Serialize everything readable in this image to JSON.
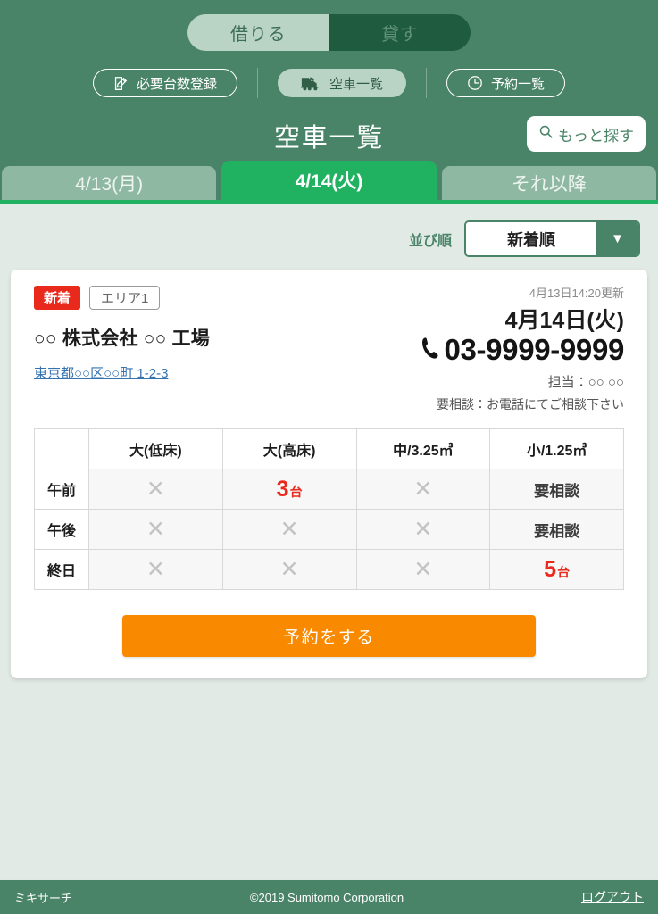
{
  "header": {
    "mode_toggle": {
      "borrow_label": "借りる",
      "lend_label": "貸す",
      "selected": "借りる"
    },
    "nav": [
      {
        "label": "必要台数登録",
        "icon": "edit-document-icon",
        "active": false
      },
      {
        "label": "空車一覧",
        "icon": "truck-icon",
        "active": true
      },
      {
        "label": "予約一覧",
        "icon": "clock-icon",
        "active": false
      }
    ],
    "page_title": "空車一覧",
    "search_button": {
      "label": "もっと探す",
      "icon": "search-icon"
    },
    "tabs": [
      {
        "label": "4/13(月)",
        "active": false
      },
      {
        "label": "4/14(火)",
        "active": true
      },
      {
        "label": "それ以降",
        "active": false
      }
    ]
  },
  "sort": {
    "label": "並び順",
    "value": "新着順",
    "arrow": "▼"
  },
  "card": {
    "badge_new": "新着",
    "badge_area": "エリア1",
    "company": "○○ 株式会社 ○○ 工場",
    "address": "東京都○○区○○町 1-2-3",
    "updated": "4月13日14:20更新",
    "reservation_date": "4月14日(火)",
    "phone": "03-9999-9999",
    "phone_icon": "phone-icon",
    "person": "担当：○○ ○○",
    "note": "要相談：お電話にてご相談下さい",
    "reserve_button": "予約をする"
  },
  "table": {
    "corner": "",
    "columns": [
      "大(低床)",
      "大(高床)",
      "中/3.25㎥",
      "小/1.25㎥"
    ],
    "rows": [
      {
        "label": "午前",
        "cells": [
          {
            "type": "none",
            "text": "✕"
          },
          {
            "type": "count",
            "value": "3",
            "unit": "台"
          },
          {
            "type": "none",
            "text": "✕"
          },
          {
            "type": "consult",
            "text": "要相談"
          }
        ]
      },
      {
        "label": "午後",
        "cells": [
          {
            "type": "none",
            "text": "✕"
          },
          {
            "type": "none",
            "text": "✕"
          },
          {
            "type": "none",
            "text": "✕"
          },
          {
            "type": "consult",
            "text": "要相談"
          }
        ]
      },
      {
        "label": "終日",
        "cells": [
          {
            "type": "none",
            "text": "✕"
          },
          {
            "type": "none",
            "text": "✕"
          },
          {
            "type": "none",
            "text": "✕"
          },
          {
            "type": "count",
            "value": "5",
            "unit": "台"
          }
        ]
      }
    ]
  },
  "footer": {
    "left": "ミキサーチ",
    "copyright": "©2019 Sumitomo Corporation",
    "logout": "ログアウト"
  },
  "colors": {
    "header_green": "#4a8468",
    "active_tab_green": "#20b261",
    "inactive_tab_green": "#8fb8a3",
    "page_bg": "#e2eae5",
    "accent_orange": "#f98a00",
    "badge_red": "#e8291c",
    "link_blue": "#3572b0"
  }
}
